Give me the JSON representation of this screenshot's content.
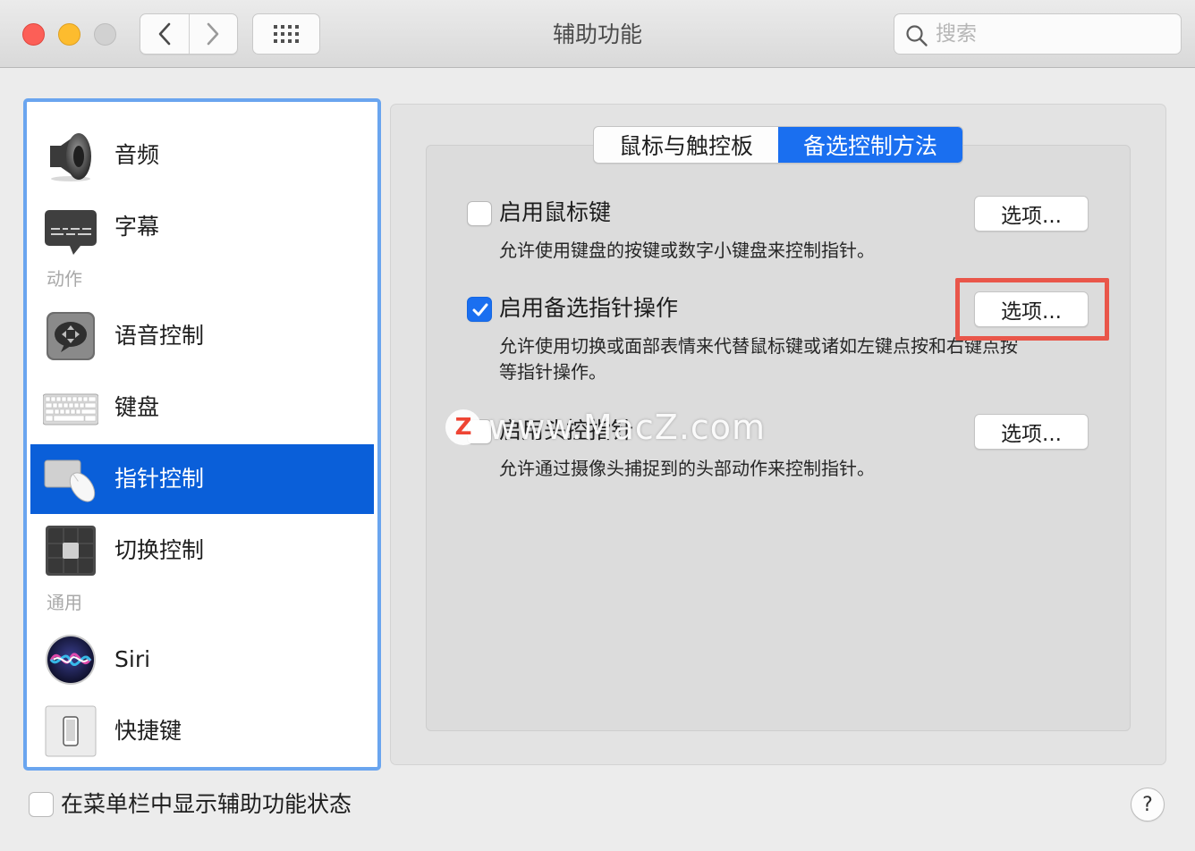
{
  "window": {
    "title": "辅助功能",
    "search_placeholder": "搜索"
  },
  "sidebar": {
    "items": [
      {
        "label": "音频",
        "icon": "speaker-icon"
      },
      {
        "label": "字幕",
        "icon": "captions-icon"
      },
      {
        "label": "语音控制",
        "icon": "voice-control-icon"
      },
      {
        "label": "键盘",
        "icon": "keyboard-icon"
      },
      {
        "label": "指针控制",
        "icon": "pointer-control-icon",
        "selected": true
      },
      {
        "label": "切换控制",
        "icon": "switch-control-icon"
      },
      {
        "label": "Siri",
        "icon": "siri-icon"
      },
      {
        "label": "快捷键",
        "icon": "shortcut-icon"
      }
    ],
    "sections": {
      "motor": "动作",
      "general": "通用"
    }
  },
  "tabs": [
    {
      "label": "鼠标与触控板",
      "active": false
    },
    {
      "label": "备选控制方法",
      "active": true
    }
  ],
  "options": [
    {
      "title": "启用鼠标键",
      "desc": "允许使用键盘的按键或数字小键盘来控制指针。",
      "checked": false,
      "button": "选项..."
    },
    {
      "title": "启用备选指针操作",
      "desc": "允许使用切换或面部表情来代替鼠标键或诸如左键点按和右键点按等指针操作。",
      "checked": true,
      "button": "选项..."
    },
    {
      "title": "启用头控指针",
      "desc": "允许通过摄像头捕捉到的头部动作来控制指针。",
      "checked": false,
      "button": "选项..."
    }
  ],
  "watermark": {
    "logo": "Z",
    "text": "www.MacZ.com"
  },
  "footer": {
    "show_status_label": "在菜单栏中显示辅助功能状态",
    "help": "?"
  },
  "colors": {
    "accent": "#1a6ff0",
    "selection": "#0a5fd9",
    "highlight_box": "#e9564a",
    "sidebar_focus_ring": "#6aa5ef"
  }
}
